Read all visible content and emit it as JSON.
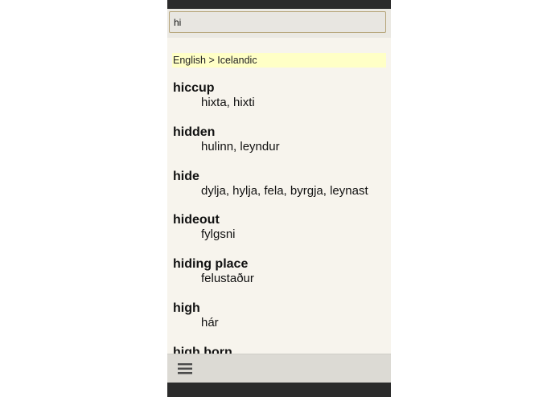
{
  "search": {
    "value": "hi"
  },
  "dictionary": {
    "direction": "English > Icelandic"
  },
  "entries": [
    {
      "term": "hiccup",
      "translation": "hixta, hixti"
    },
    {
      "term": "hidden",
      "translation": "hulinn, leyndur"
    },
    {
      "term": "hide",
      "translation": "dylja, hylja, fela, byrgja, leynast"
    },
    {
      "term": "hideout",
      "translation": "fylgsni"
    },
    {
      "term": "hiding place",
      "translation": "felustaður"
    },
    {
      "term": "high",
      "translation": "hár"
    },
    {
      "term": "high born",
      "translation": ""
    }
  ],
  "icons": {
    "menu": "hamburger-menu-icon"
  },
  "colors": {
    "header_highlight": "#ffffc6",
    "background": "#f7f4ed",
    "status_bar": "#2b2b2b",
    "search_border": "#b6a57a"
  }
}
